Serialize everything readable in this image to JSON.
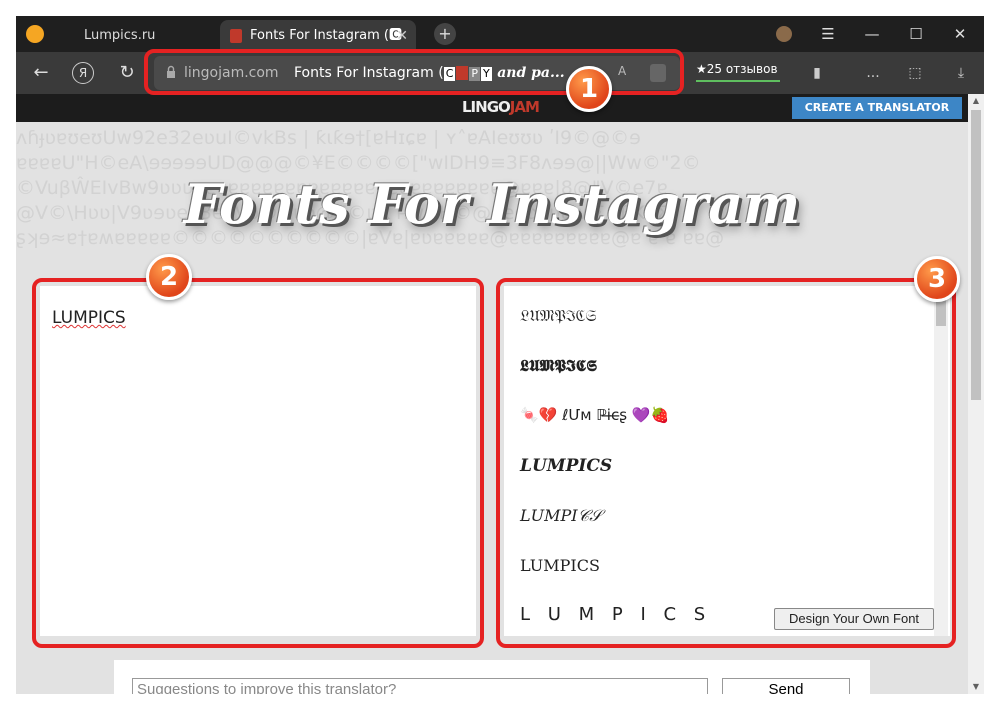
{
  "browser": {
    "tabs": [
      {
        "label": "Lumpics.ru"
      },
      {
        "label": "Fonts For Instagram (🅲"
      }
    ],
    "tab_close": "✕",
    "new_tab": "+",
    "window": {
      "menu": "☰",
      "minimize": "—",
      "maximize": "☐",
      "close": "✕"
    },
    "nav": {
      "back": "←",
      "yandex": "Я",
      "reload": "↻"
    },
    "address": {
      "domain": "lingojam.com",
      "title_prefix": "Fonts For Instagram (",
      "boxed_c": "C",
      "boxed_p": "P",
      "boxed_y": "Y",
      "title_styled": "and pa...",
      "translate": "A"
    },
    "reviews": "★25 отзывов",
    "toolbar_icons": {
      "bookmark": "▮",
      "more": "...",
      "extensions": "⬚",
      "downloads": "⤓"
    }
  },
  "callouts": {
    "one": "1",
    "two": "2",
    "three": "3"
  },
  "site": {
    "logo_main": "LINGO",
    "logo_accent": "JAM",
    "create_button": "CREATE A TRANSLATOR",
    "background_lines": [
      "ʌɦɟʋɐʊeʊUw92e32eʋuI©vkBs | ƙɩƙɘ†[ɐHɪɕɐ | ʏ˄ɐAIeʊʊʋ ʹI9©@©ɘ",
      "ɐɐɐɐU\"H©eA\\ɘɘɘɘɘUD@@@©¥E©©©©[\"wIDH9≡3F8ʌɘɘ@||Ww©\"2©",
      "©VuβŴEIvBw9ʋʋʋɐɐɐɐɐɐɐɐɐɐɐɐɐɐɐɐɐɐɐɐɐɐɐɐɐɐɐ@ɐɐɐ|8@\"V©e7ɐ",
      "@V©\\Ηʋʋ|V9ʋɘʋeɘ3eʋVʋ©Dʋʋ@Ʒ©ʋK ʜw \"H©@ɘeɘʋʋʋʋwIΣʍβΚʋΣʋ",
      "ʂʞɘ≈ɐ†ɐʍɐɐɐɐɐ©©©©©©©©©©|ɐVɐ|ɐʋɐɐɐɐɐ@ɐɐɐɐɐɐɐɐɐ@ɐ ɐ ɐ ɐɐ@"
    ],
    "headline": "Fonts For Instagram",
    "input_text": "LUMPICS",
    "outputs": [
      "𝔏𝔘𝔐𝔓ℑℭ𝔖",
      "𝕷𝖀𝕸𝕻𝕴𝕮𝕾",
      "🍬💔  ℓՄм  ℙi̶c̶ʂ  💜🍓",
      "𝑳𝑼𝑴𝑷𝑰𝑪𝑺",
      "𝐿𝑈𝑀𝑃𝐼𝒞𝒮",
      "LUMPICS",
      "L U M P I C S"
    ],
    "design_button": "Design Your Own Font",
    "suggest_placeholder": "Suggestions to improve this translator?",
    "send_button": "Send"
  }
}
